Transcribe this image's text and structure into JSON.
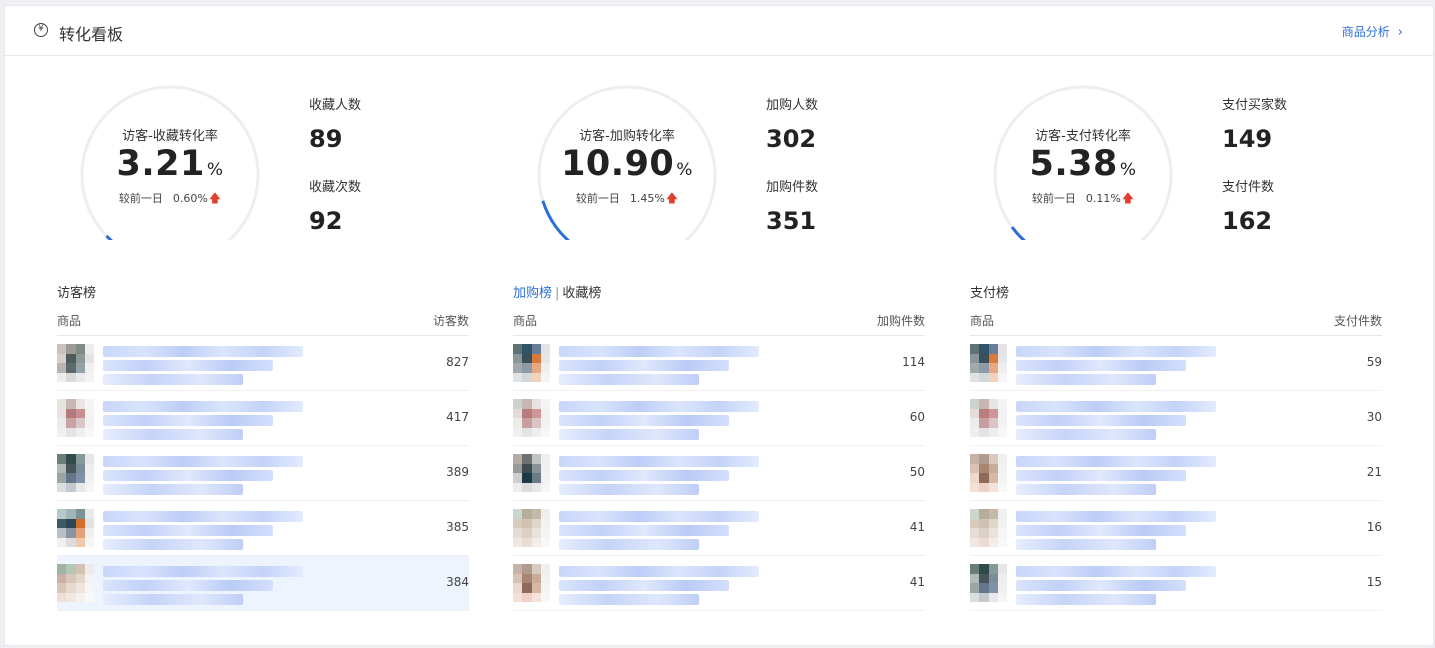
{
  "header": {
    "title": "转化看板",
    "icon": "yen-circle-icon",
    "link_label": "商品分析",
    "link_chevron": "›"
  },
  "metrics": [
    {
      "gauge_label": "访客-收藏转化率",
      "rate": "3.21",
      "unit": "%",
      "compare_label": "较前一日",
      "delta": "0.60%",
      "trend": "up",
      "fill": 0.0321,
      "stat1_label": "收藏人数",
      "stat1_value": "89",
      "stat2_label": "收藏次数",
      "stat2_value": "92"
    },
    {
      "gauge_label": "访客-加购转化率",
      "rate": "10.90",
      "unit": "%",
      "compare_label": "较前一日",
      "delta": "1.45%",
      "trend": "up",
      "fill": 0.109,
      "stat1_label": "加购人数",
      "stat1_value": "302",
      "stat2_label": "加购件数",
      "stat2_value": "351"
    },
    {
      "gauge_label": "访客-支付转化率",
      "rate": "5.38",
      "unit": "%",
      "compare_label": "较前一日",
      "delta": "0.11%",
      "trend": "up",
      "fill": 0.0538,
      "stat1_label": "支付买家数",
      "stat1_value": "149",
      "stat2_label": "支付件数",
      "stat2_value": "162"
    }
  ],
  "up_arrow": "🡅",
  "boards": [
    {
      "title": "访客榜",
      "col_item": "商品",
      "col_count": "访客数",
      "rows": [
        {
          "count": "827"
        },
        {
          "count": "417"
        },
        {
          "count": "389"
        },
        {
          "count": "385"
        },
        {
          "count": "384"
        }
      ]
    },
    {
      "tab_active": "加购榜",
      "tab_sep": "|",
      "tab_other": "收藏榜",
      "col_item": "商品",
      "col_count": "加购件数",
      "rows": [
        {
          "count": "114"
        },
        {
          "count": "60"
        },
        {
          "count": "50"
        },
        {
          "count": "41"
        },
        {
          "count": "41"
        }
      ]
    },
    {
      "title": "支付榜",
      "col_item": "商品",
      "col_count": "支付件数",
      "rows": [
        {
          "count": "59"
        },
        {
          "count": "30"
        },
        {
          "count": "21"
        },
        {
          "count": "16"
        },
        {
          "count": "15"
        }
      ]
    }
  ],
  "colors": {
    "accent": "#2c6fd9",
    "gauge_track": "#eeeeee",
    "up": "#e0412e",
    "highlight_row": "#eef4fd"
  }
}
